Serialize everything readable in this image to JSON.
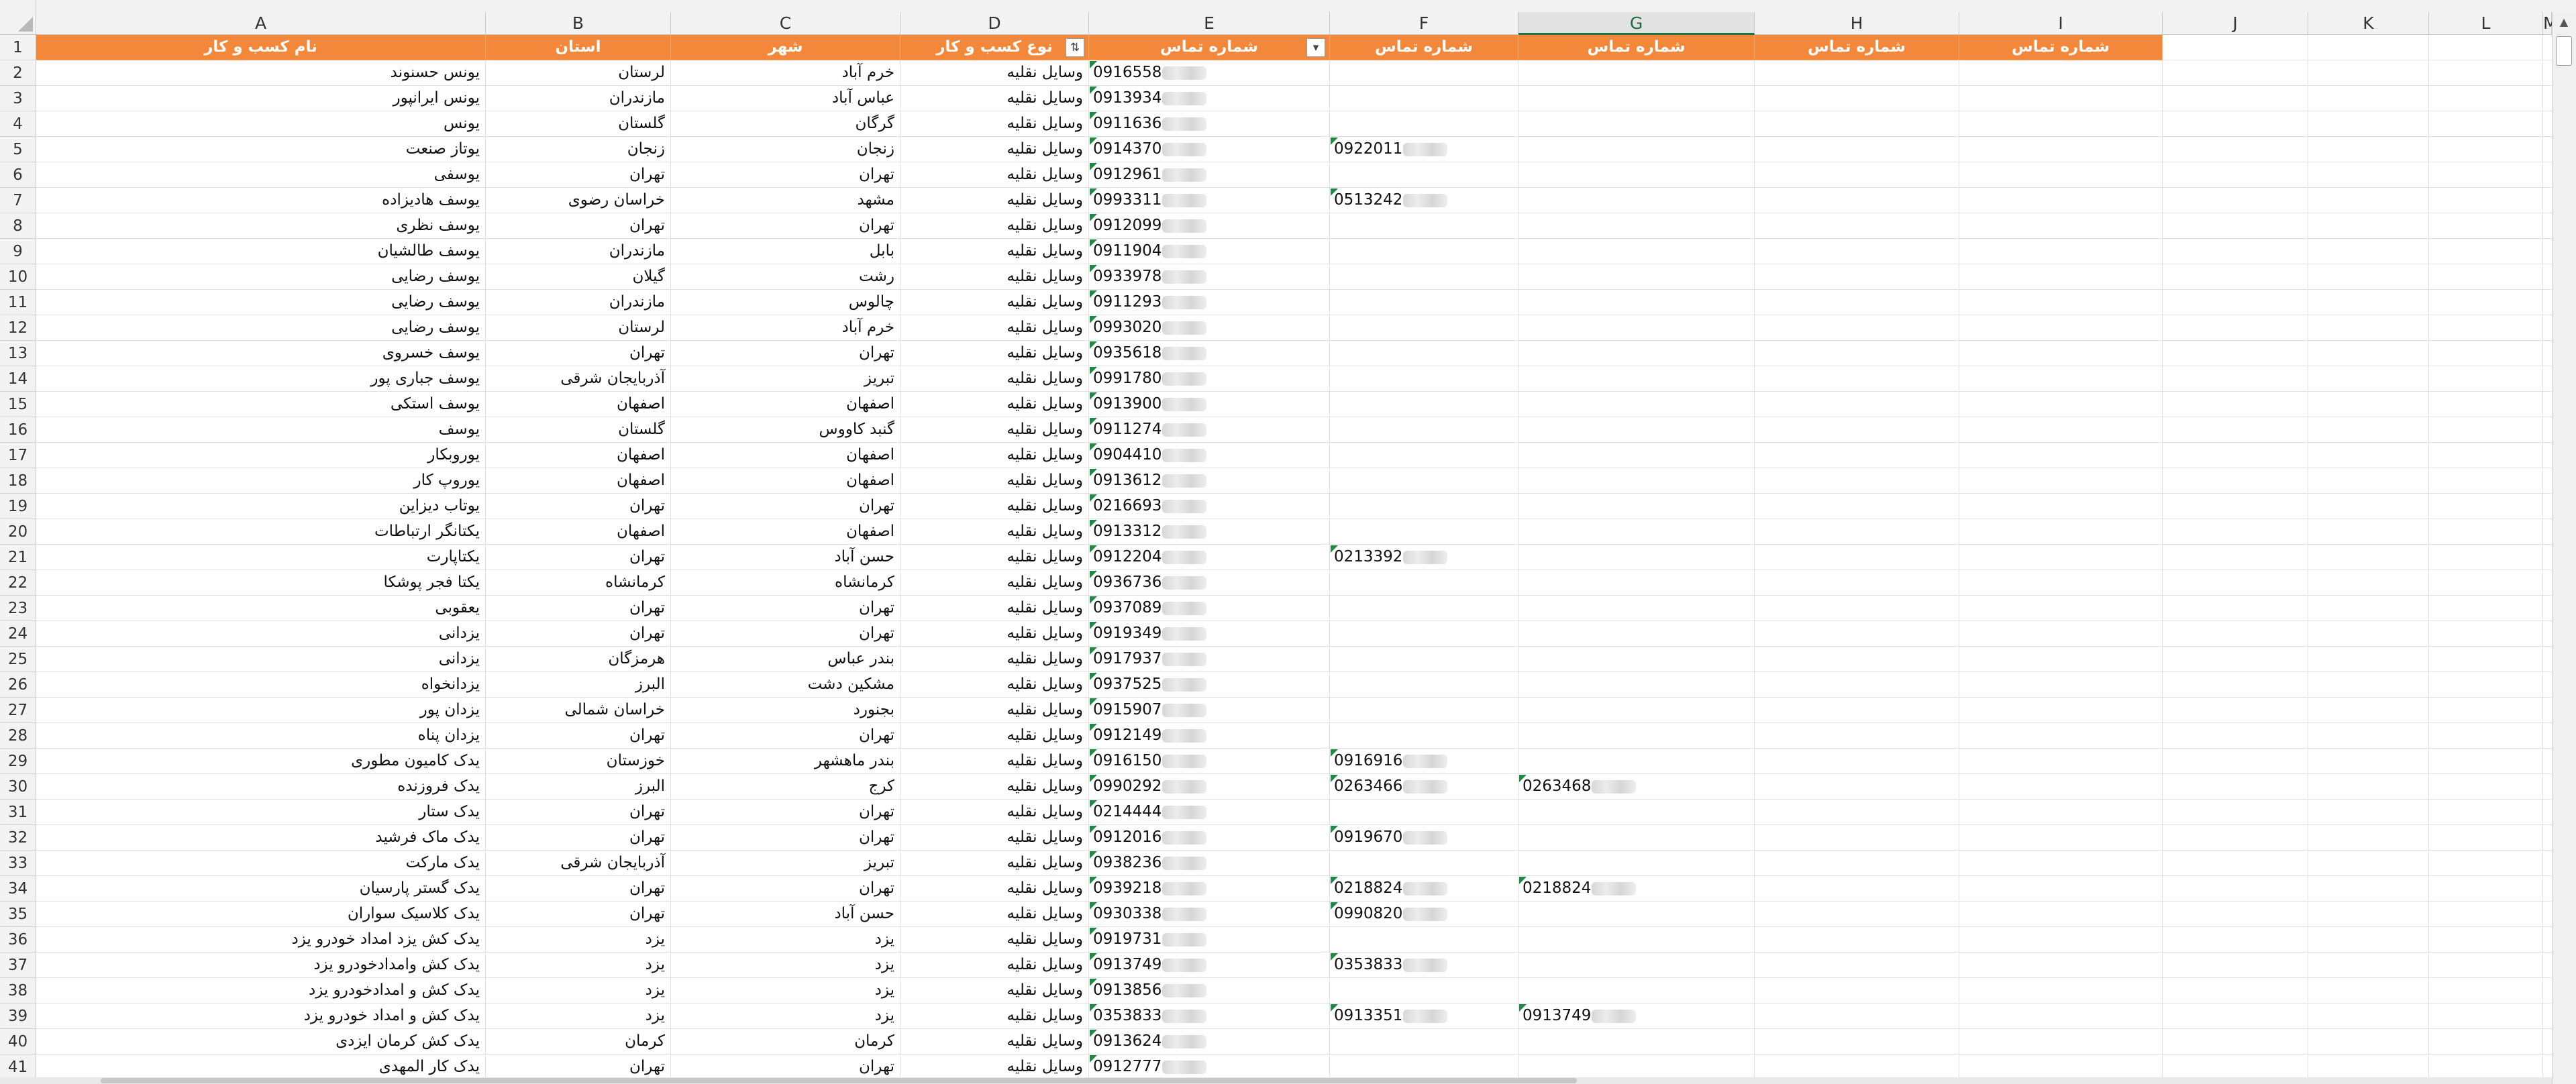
{
  "columns": [
    "A",
    "B",
    "C",
    "D",
    "E",
    "F",
    "G",
    "H",
    "I",
    "J",
    "K",
    "L",
    "M"
  ],
  "headers": {
    "A": "نام کسب و کار",
    "B": "استان",
    "C": "شهر",
    "D": "نوع کسب و کار",
    "E": "شماره تماس",
    "F": "شماره تماس",
    "G": "شماره تماس",
    "H": "شماره تماس",
    "I": "شماره تماس"
  },
  "filter_icons": {
    "D": "sort-filter-icon",
    "E": "filter-dropdown-icon"
  },
  "colors": {
    "header_fill": "#f4883a",
    "header_text": "#ffffff",
    "flag": "#1e8a44"
  },
  "rows": [
    {
      "n": 2,
      "name": "یونس حسنوند",
      "prov": "لرستان",
      "city": "خرم آباد",
      "type": "وسایل نقلیه",
      "e": "0916558"
    },
    {
      "n": 3,
      "name": "یونس ایرانپور",
      "prov": "مازندران",
      "city": "عباس آباد",
      "type": "وسایل نقلیه",
      "e": "0913934"
    },
    {
      "n": 4,
      "name": "یونس",
      "prov": "گلستان",
      "city": "گرگان",
      "type": "وسایل نقلیه",
      "e": "0911636"
    },
    {
      "n": 5,
      "name": "یوتاز صنعت",
      "prov": "زنجان",
      "city": "زنجان",
      "type": "وسایل نقلیه",
      "e": "0914370",
      "f": "0922011"
    },
    {
      "n": 6,
      "name": "یوسفی",
      "prov": "تهران",
      "city": "تهران",
      "type": "وسایل نقلیه",
      "e": "0912961"
    },
    {
      "n": 7,
      "name": "یوسف هادیزاده",
      "prov": "خراسان رضوی",
      "city": "مشهد",
      "type": "وسایل نقلیه",
      "e": "0993311",
      "f": "0513242"
    },
    {
      "n": 8,
      "name": "یوسف نظری",
      "prov": "تهران",
      "city": "تهران",
      "type": "وسایل نقلیه",
      "e": "0912099"
    },
    {
      "n": 9,
      "name": "یوسف طالشیان",
      "prov": "مازندران",
      "city": "بابل",
      "type": "وسایل نقلیه",
      "e": "0911904"
    },
    {
      "n": 10,
      "name": "یوسف رضایی",
      "prov": "گیلان",
      "city": "رشت",
      "type": "وسایل نقلیه",
      "e": "0933978"
    },
    {
      "n": 11,
      "name": "یوسف رضایی",
      "prov": "مازندران",
      "city": "چالوس",
      "type": "وسایل نقلیه",
      "e": "0911293"
    },
    {
      "n": 12,
      "name": "یوسف رضایی",
      "prov": "لرستان",
      "city": "خرم آباد",
      "type": "وسایل نقلیه",
      "e": "0993020"
    },
    {
      "n": 13,
      "name": "یوسف خسروی",
      "prov": "تهران",
      "city": "تهران",
      "type": "وسایل نقلیه",
      "e": "0935618"
    },
    {
      "n": 14,
      "name": "یوسف جباری پور",
      "prov": "آذربایجان شرقی",
      "city": "تبریز",
      "type": "وسایل نقلیه",
      "e": "0991780"
    },
    {
      "n": 15,
      "name": "یوسف استکی",
      "prov": "اصفهان",
      "city": "اصفهان",
      "type": "وسایل نقلیه",
      "e": "0913900"
    },
    {
      "n": 16,
      "name": "یوسف",
      "prov": "گلستان",
      "city": "گنبد کاووس",
      "type": "وسایل نقلیه",
      "e": "0911274"
    },
    {
      "n": 17,
      "name": "یوروبکار",
      "prov": "اصفهان",
      "city": "اصفهان",
      "type": "وسایل نقلیه",
      "e": "0904410"
    },
    {
      "n": 18,
      "name": "یوروپ کار",
      "prov": "اصفهان",
      "city": "اصفهان",
      "type": "وسایل نقلیه",
      "e": "0913612"
    },
    {
      "n": 19,
      "name": "یوتاب دیزاین",
      "prov": "تهران",
      "city": "تهران",
      "type": "وسایل نقلیه",
      "e": "0216693"
    },
    {
      "n": 20,
      "name": "یکتانگر ارتباطات",
      "prov": "اصفهان",
      "city": "اصفهان",
      "type": "وسایل نقلیه",
      "e": "0913312"
    },
    {
      "n": 21,
      "name": "یکتاپارت",
      "prov": "تهران",
      "city": "حسن آباد",
      "type": "وسایل نقلیه",
      "e": "0912204",
      "f": "0213392"
    },
    {
      "n": 22,
      "name": "یکتا فجر پوشکا",
      "prov": "کرمانشاه",
      "city": "کرمانشاه",
      "type": "وسایل نقلیه",
      "e": "0936736"
    },
    {
      "n": 23,
      "name": "یعقوبی",
      "prov": "تهران",
      "city": "تهران",
      "type": "وسایل نقلیه",
      "e": "0937089"
    },
    {
      "n": 24,
      "name": "یزدانی",
      "prov": "تهران",
      "city": "تهران",
      "type": "وسایل نقلیه",
      "e": "0919349"
    },
    {
      "n": 25,
      "name": "یزدانی",
      "prov": "هرمزگان",
      "city": "بندر عباس",
      "type": "وسایل نقلیه",
      "e": "0917937"
    },
    {
      "n": 26,
      "name": "یزدانخواه",
      "prov": "البرز",
      "city": "مشکین دشت",
      "type": "وسایل نقلیه",
      "e": "0937525"
    },
    {
      "n": 27,
      "name": "یزدان پور",
      "prov": "خراسان شمالی",
      "city": "بجنورد",
      "type": "وسایل نقلیه",
      "e": "0915907"
    },
    {
      "n": 28,
      "name": "یزدان پناه",
      "prov": "تهران",
      "city": "تهران",
      "type": "وسایل نقلیه",
      "e": "0912149"
    },
    {
      "n": 29,
      "name": "یدک کامیون مطوری",
      "prov": "خوزستان",
      "city": "بندر ماهشهر",
      "type": "وسایل نقلیه",
      "e": "0916150",
      "f": "0916916"
    },
    {
      "n": 30,
      "name": "یدک فروزنده",
      "prov": "البرز",
      "city": "کرج",
      "type": "وسایل نقلیه",
      "e": "0990292",
      "f": "0263466",
      "g": "0263468"
    },
    {
      "n": 31,
      "name": "یدک ستار",
      "prov": "تهران",
      "city": "تهران",
      "type": "وسایل نقلیه",
      "e": "0214444"
    },
    {
      "n": 32,
      "name": "یدک ماک فرشید",
      "prov": "تهران",
      "city": "تهران",
      "type": "وسایل نقلیه",
      "e": "0912016",
      "f": "0919670"
    },
    {
      "n": 33,
      "name": "یدک مارکت",
      "prov": "آذربایجان شرقی",
      "city": "تبریز",
      "type": "وسایل نقلیه",
      "e": "0938236"
    },
    {
      "n": 34,
      "name": "یدک گستر پارسیان",
      "prov": "تهران",
      "city": "تهران",
      "type": "وسایل نقلیه",
      "e": "0939218",
      "f": "0218824",
      "g": "0218824"
    },
    {
      "n": 35,
      "name": "یدک کلاسیک سواران",
      "prov": "تهران",
      "city": "حسن آباد",
      "type": "وسایل نقلیه",
      "e": "0930338",
      "f": "0990820"
    },
    {
      "n": 36,
      "name": "یدک کش یزد امداد خودرو یزد",
      "prov": "یزد",
      "city": "یزد",
      "type": "وسایل نقلیه",
      "e": "0919731"
    },
    {
      "n": 37,
      "name": "یدک کش وامدادخودرو یزد",
      "prov": "یزد",
      "city": "یزد",
      "type": "وسایل نقلیه",
      "e": "0913749",
      "f": "0353833"
    },
    {
      "n": 38,
      "name": "یدک کش و امدادخودرو یزد",
      "prov": "یزد",
      "city": "یزد",
      "type": "وسایل نقلیه",
      "e": "0913856"
    },
    {
      "n": 39,
      "name": "یدک کش و امداد خودرو یزد",
      "prov": "یزد",
      "city": "یزد",
      "type": "وسایل نقلیه",
      "e": "0353833",
      "f": "0913351",
      "g": "0913749"
    },
    {
      "n": 40,
      "name": "یدک کش کرمان ایزدی",
      "prov": "کرمان",
      "city": "کرمان",
      "type": "وسایل نقلیه",
      "e": "0913624"
    },
    {
      "n": 41,
      "name": "یدک کار المهدی",
      "prov": "تهران",
      "city": "تهران",
      "type": "وسایل نقلیه",
      "e": "0912777"
    }
  ]
}
